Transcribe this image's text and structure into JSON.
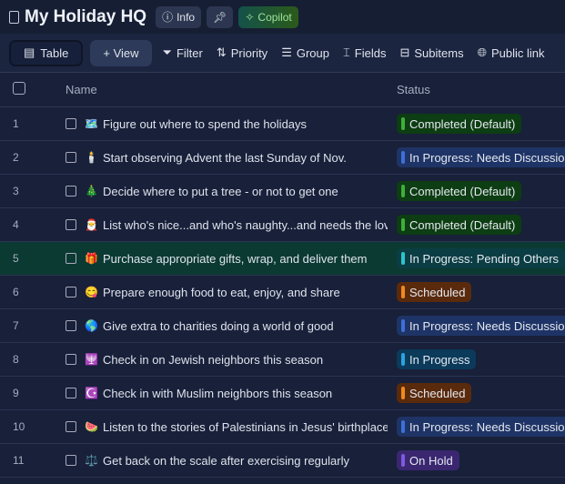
{
  "header": {
    "title": "My Holiday HQ",
    "info": "Info",
    "copilot": "Copilot"
  },
  "toolbar": {
    "table": "Table",
    "view": "+ View",
    "filter": "Filter",
    "priority": "Priority",
    "group": "Group",
    "fields": "Fields",
    "subitems": "Subitems",
    "public_link": "Public link"
  },
  "columns": {
    "name": "Name",
    "status": "Status"
  },
  "statuses": {
    "completed": {
      "bg": "#0d3d12",
      "bar": "#3fae3a"
    },
    "needs": {
      "bg": "#1f3466",
      "bar": "#3f6fd8"
    },
    "pending": {
      "bg": "#0b3d44",
      "bar": "#2ec4cc"
    },
    "scheduled": {
      "bg": "#5a2a0c",
      "bar": "#ee8a1e"
    },
    "progress": {
      "bg": "#0b3a5a",
      "bar": "#2aa3e0"
    },
    "hold": {
      "bg": "#3a2770",
      "bar": "#7d5ae0"
    }
  },
  "rows": [
    {
      "num": "1",
      "emoji": "🗺️",
      "name": "Figure out where to spend the holidays",
      "status": "Completed (Default)",
      "kind": "completed"
    },
    {
      "num": "2",
      "emoji": "🕯️",
      "name": "Start observing Advent the last Sunday of Nov.",
      "status": "In Progress: Needs Discussion",
      "kind": "needs"
    },
    {
      "num": "3",
      "emoji": "🎄",
      "name": "Decide where to put a tree - or not to get one",
      "status": "Completed (Default)",
      "kind": "completed"
    },
    {
      "num": "4",
      "emoji": "🎅",
      "name": "List who's nice...and who's naughty...and needs the love",
      "status": "Completed (Default)",
      "kind": "completed"
    },
    {
      "num": "5",
      "emoji": "🎁",
      "name": "Purchase appropriate gifts, wrap, and deliver them",
      "status": "In Progress: Pending Others",
      "kind": "pending"
    },
    {
      "num": "6",
      "emoji": "😋",
      "name": "Prepare enough food to eat, enjoy, and share",
      "status": "Scheduled",
      "kind": "scheduled"
    },
    {
      "num": "7",
      "emoji": "🌎",
      "name": "Give extra to charities doing a world of good",
      "status": "In Progress: Needs Discussion",
      "kind": "needs"
    },
    {
      "num": "8",
      "emoji": "🕎",
      "name": "Check in on Jewish neighbors this season",
      "status": "In Progress",
      "kind": "progress"
    },
    {
      "num": "9",
      "emoji": "☪️",
      "name": "Check in with Muslim neighbors this season",
      "status": "Scheduled",
      "kind": "scheduled"
    },
    {
      "num": "10",
      "emoji": "🍉",
      "name": "Listen to the stories of Palestinians in Jesus' birthplace",
      "status": "In Progress: Needs Discussion",
      "kind": "needs"
    },
    {
      "num": "11",
      "emoji": "⚖️",
      "name": "Get back on the scale after exercising regularly",
      "status": "On Hold",
      "kind": "hold"
    }
  ]
}
